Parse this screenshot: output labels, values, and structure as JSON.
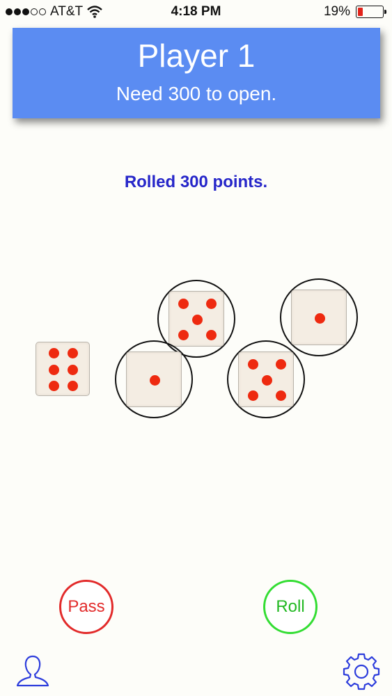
{
  "status_bar": {
    "carrier": "AT&T",
    "time": "4:18 PM",
    "battery": "19%",
    "battery_level": 0.19
  },
  "header": {
    "title": "Player 1",
    "subtitle": "Need 300 to open."
  },
  "message": "Rolled 300 points.",
  "dice": [
    {
      "value": 6,
      "selected": false
    },
    {
      "value": 5,
      "selected": true
    },
    {
      "value": 1,
      "selected": true
    },
    {
      "value": 1,
      "selected": true
    },
    {
      "value": 5,
      "selected": true
    }
  ],
  "buttons": {
    "pass": "Pass",
    "roll": "Roll"
  },
  "colors": {
    "header_bg": "#5b8cf2",
    "message": "#2626c9",
    "pip": "#ee2a10",
    "pass": "#e22a2a",
    "roll": "#33dd33",
    "toolbar_icon": "#2c3cdc"
  },
  "toolbar": {
    "left_icon": "profile-icon",
    "right_icon": "gear-icon"
  }
}
